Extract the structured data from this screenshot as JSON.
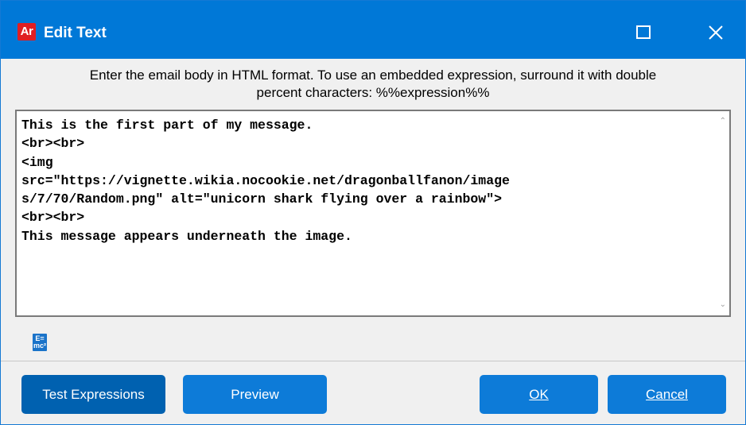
{
  "window": {
    "title": "Edit Text",
    "app_icon_label": "Ar",
    "icons": {
      "app": "ar-app-icon",
      "maximize": "maximize-icon",
      "close": "close-icon"
    }
  },
  "instructions": {
    "line1": "Enter the email body in HTML format. To use an embedded expression, surround it with double",
    "line2": "percent characters: %%expression%%"
  },
  "editor": {
    "value": "This is the first part of my message.\n<br><br>\n<img\nsrc=\"https://vignette.wikia.nocookie.net/dragonballfanon/image\ns/7/70/Random.png\" alt=\"unicorn shark flying over a rainbow\">\n<br><br>\nThis message appears underneath the image."
  },
  "toolbar": {
    "expression_icon_label_top": "E=",
    "expression_icon_label_bottom": "mc²",
    "expression_icon": "expression-builder-icon"
  },
  "buttons": {
    "test_expressions": "Test Expressions",
    "preview": "Preview",
    "ok": "OK",
    "cancel": "Cancel"
  },
  "colors": {
    "titlebar": "#0078d7",
    "button": "#0d7bd8",
    "button_active": "#0061b0",
    "app_icon": "#e01e22"
  }
}
